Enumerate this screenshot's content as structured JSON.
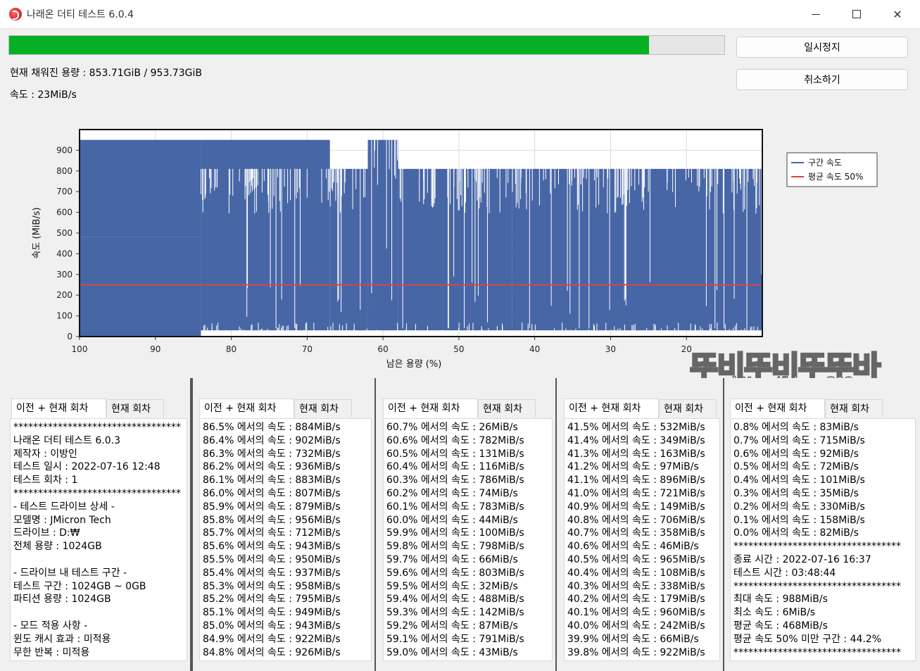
{
  "window": {
    "title": "나래온 더티 테스트 6.0.4",
    "app_icon": "app-logo-icon"
  },
  "progress": {
    "fill_fraction": 0.895,
    "color": "#06b025"
  },
  "status": {
    "filled_capacity": "현재 채워진 용량 : 853.71GiB / 953.73GiB",
    "speed": "속도 : 23MiB/s"
  },
  "buttons": {
    "pause": "일시정지",
    "cancel": "취소하기"
  },
  "chart_data": {
    "type": "area",
    "xlabel": "남은 용량 (%)",
    "ylabel": "속도 (MiB/s)",
    "x_range": [
      100,
      10
    ],
    "x_ticks": [
      "100",
      "90",
      "80",
      "70",
      "60",
      "50",
      "40",
      "30",
      "20"
    ],
    "ylim": [
      0,
      1000
    ],
    "y_ticks": [
      "0",
      "100",
      "200",
      "300",
      "400",
      "500",
      "600",
      "700",
      "800",
      "900"
    ],
    "grid": true,
    "legend_position": "top-right",
    "series": [
      {
        "name": "구간 속도",
        "color": "#4766a6",
        "segments": [
          {
            "x_from": 100,
            "x_to": 84,
            "low": 0,
            "high": 480
          },
          {
            "x_from": 100,
            "x_to": 84,
            "low": 480,
            "high": 950
          },
          {
            "x_from": 84,
            "x_to": 67,
            "low": 30,
            "high": 950
          },
          {
            "x_from": 67,
            "x_to": 62,
            "low": 30,
            "high": 810
          },
          {
            "x_from": 62,
            "x_to": 58,
            "low": 30,
            "high": 950
          },
          {
            "x_from": 58,
            "x_to": 43,
            "low": 30,
            "high": 810
          },
          {
            "x_from": 43,
            "x_to": 10,
            "low": 30,
            "high": 810
          }
        ]
      },
      {
        "name": "평균 속도 50%",
        "color": "#d64545",
        "values": [
          250,
          250
        ]
      }
    ]
  },
  "panels": [
    {
      "tabs": [
        "이전 + 현재 회차",
        "현재 회차"
      ],
      "lines": [
        "**********************************",
        "나래온 더티 테스트 6.0.3",
        "제작자 : 이방인",
        "테스트 일시 : 2022-07-16 12:48",
        "테스트 회차 : 1",
        "**********************************",
        "- 테스트 드라이브 상세 -",
        "모델명 : JMicron Tech",
        "드라이브 : D:₩",
        "전체 용량 : 1024GB",
        "",
        "- 드라이브 내 테스트 구간 -",
        "테스트 구간 : 1024GB ~ 0GB",
        "파티션 용량 : 1024GB",
        "",
        "- 모드 적용 사항 -",
        "윈도 캐시 효과 : 미적용",
        "무한 반복 : 미적용"
      ]
    },
    {
      "tabs": [
        "이전 + 현재 회차",
        "현재 회차"
      ],
      "lines": [
        "86.5% 에서의 속도 : 884MiB/s",
        "86.4% 에서의 속도 : 902MiB/s",
        "86.3% 에서의 속도 : 732MiB/s",
        "86.2% 에서의 속도 : 936MiB/s",
        "86.1% 에서의 속도 : 883MiB/s",
        "86.0% 에서의 속도 : 807MiB/s",
        "85.9% 에서의 속도 : 879MiB/s",
        "85.8% 에서의 속도 : 956MiB/s",
        "85.7% 에서의 속도 : 712MiB/s",
        "85.6% 에서의 속도 : 943MiB/s",
        "85.5% 에서의 속도 : 950MiB/s",
        "85.4% 에서의 속도 : 937MiB/s",
        "85.3% 에서의 속도 : 958MiB/s",
        "85.2% 에서의 속도 : 795MiB/s",
        "85.1% 에서의 속도 : 949MiB/s",
        "85.0% 에서의 속도 : 943MiB/s",
        "84.9% 에서의 속도 : 922MiB/s",
        "84.8% 에서의 속도 : 926MiB/s"
      ]
    },
    {
      "tabs": [
        "이전 + 현재 회차",
        "현재 회차"
      ],
      "lines": [
        "60.7% 에서의 속도 : 26MiB/s",
        "60.6% 에서의 속도 : 782MiB/s",
        "60.5% 에서의 속도 : 131MiB/s",
        "60.4% 에서의 속도 : 116MiB/s",
        "60.3% 에서의 속도 : 786MiB/s",
        "60.2% 에서의 속도 : 74MiB/s",
        "60.1% 에서의 속도 : 783MiB/s",
        "60.0% 에서의 속도 : 44MiB/s",
        "59.9% 에서의 속도 : 100MiB/s",
        "59.8% 에서의 속도 : 798MiB/s",
        "59.7% 에서의 속도 : 66MiB/s",
        "59.6% 에서의 속도 : 803MiB/s",
        "59.5% 에서의 속도 : 32MiB/s",
        "59.4% 에서의 속도 : 488MiB/s",
        "59.3% 에서의 속도 : 142MiB/s",
        "59.2% 에서의 속도 : 87MiB/s",
        "59.1% 에서의 속도 : 791MiB/s",
        "59.0% 에서의 속도 : 43MiB/s"
      ]
    },
    {
      "tabs": [
        "이전 + 현재 회차",
        "현재 회차"
      ],
      "lines": [
        "41.5% 에서의 속도 : 532MiB/s",
        "41.4% 에서의 속도 : 349MiB/s",
        "41.3% 에서의 속도 : 163MiB/s",
        "41.2% 에서의 속도 : 97MiB/s",
        "41.1% 에서의 속도 : 896MiB/s",
        "41.0% 에서의 속도 : 721MiB/s",
        "40.9% 에서의 속도 : 149MiB/s",
        "40.8% 에서의 속도 : 706MiB/s",
        "40.7% 에서의 속도 : 358MiB/s",
        "40.6% 에서의 속도 : 46MiB/s",
        "40.5% 에서의 속도 : 965MiB/s",
        "40.4% 에서의 속도 : 108MiB/s",
        "40.3% 에서의 속도 : 338MiB/s",
        "40.2% 에서의 속도 : 179MiB/s",
        "40.1% 에서의 속도 : 960MiB/s",
        "40.0% 에서의 속도 : 242MiB/s",
        "39.9% 에서의 속도 : 66MiB/s",
        "39.8% 에서의 속도 : 922MiB/s"
      ]
    },
    {
      "tabs": [
        "이전 + 현재 회차",
        "현재 회차"
      ],
      "lines": [
        "0.8% 에서의 속도 : 83MiB/s",
        "0.7% 에서의 속도 : 715MiB/s",
        "0.6% 에서의 속도 : 92MiB/s",
        "0.5% 에서의 속도 : 72MiB/s",
        "0.4% 에서의 속도 : 101MiB/s",
        "0.3% 에서의 속도 : 35MiB/s",
        "0.2% 에서의 속도 : 330MiB/s",
        "0.1% 에서의 속도 : 158MiB/s",
        "0.0% 에서의 속도 : 82MiB/s",
        "**********************************",
        "종료 시간 : 2022-07-16 16:37",
        "테스트 시간 : 03:48:44",
        "**********************************",
        "최대 속도 : 988MiB/s",
        "최소 속도 : 6MiB/s",
        "평균 속도 : 468MiB/s",
        "평균 속도 50% 미만 구간 : 44.2%",
        "**********************************"
      ]
    }
  ],
  "watermark": {
    "main": "뚜비뚜비뚜뚜바",
    "url": "https://idsam209.com"
  }
}
